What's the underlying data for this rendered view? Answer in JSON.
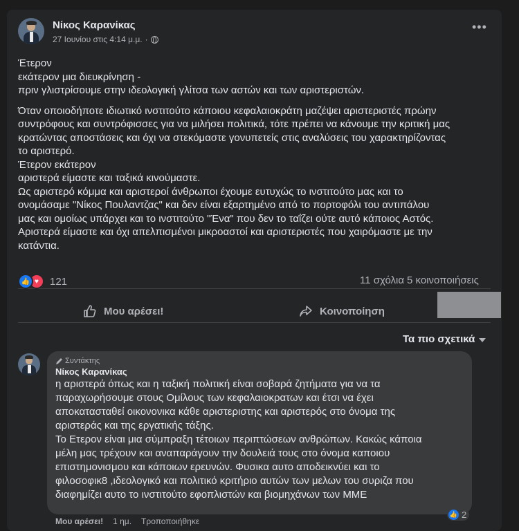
{
  "post": {
    "author": "Νίκος Καρανίκας",
    "timestamp": "27 Ιουνίου στις 4:14 μ.μ.",
    "separator": "·",
    "body": [
      "Έτερον",
      "εκάτερον μια διευκρίνηση -",
      "πριν γλιστρίσουμε στην ιδεολογική γλίτσα των αστών και των αριστεριστών.",
      "",
      "Όταν οποιοδήποτε ιδιωτικό ινστιτούτο κάποιου  κεφαλαιοκράτη μαζέψει αριστεριστές πρώην",
      "συντρόφους και συντρόφισσες για να μιλήσει πολιτικά, τότε πρέπει να κάνουμε την κριτική μας",
      "κρατώντας αποστάσεις και όχι να στεκόμαστε γονυπετείς στις αναλύσεις του χαρακτηρίζοντας",
      "το αριστερό.",
      "Έτερον εκάτερον",
      "αριστερά είμαστε και ταξικά κινούμαστε.",
      "Ως αριστερό κόμμα και αριστεροί άνθρωποι έχουμε ευτυχώς το ινστιτούτο μας και το",
      "ονομάσαμε \"Νίκος Πουλαντζας\" και δεν είναι εξαρτημένο από το πορτοφόλι του αντιπάλου",
      "μας και ομοίως υπάρχει και το ινστιτούτο \"Ένα\"  που δεν το ταΐζει ούτε αυτό κάποιος Αστός.",
      "Αριστερά είμαστε και όχι απελπισμένοι μικροαστοί και αριστεριστές που χαιρόμαστε με την",
      "κατάντια."
    ],
    "reaction_count": "121",
    "comments": "11 σχόλια",
    "shares": "5 κοινοποιήσεις",
    "like_label": "Μου αρέσει!",
    "share_label": "Κοινοποίηση",
    "sort_label": "Τα πιο σχετικά"
  },
  "comment": {
    "badge": "Συντάκτης",
    "author": "Νίκος Καρανίκας",
    "body": [
      "η αριστερά όπως και η ταξική πολιτική είναι σοβαρά ζητήματα για να τα",
      "παραχωρήσουμε στους Ομίλους των κεφαλαιοκρατων και έτσι να έχει",
      "αποκατασταθεί οικονονικα κάθε αριστεριστης και αριστερός στο όνομα της",
      "αριστεράς και της εργατικής τάξης.",
      "Το Ετερον είναι μια σύμπραξη τέτοιων περιπτώσεων ανθρώπων. Κακώς κάποια",
      "μέλη μας τρέχουν και αναπαράγουν την δουλειά τους στο όνομα καποιου",
      "επιστημονισμου και κάποιων ερευνών. Φυσικα αυτο αποδεικνύει και το",
      "φιλοσοφικ8 ,ιδεολογικό και πολιτικό κριτήριο αυτών των μελων του συριζα που",
      "διαφημίζει αυτο το ινστιτούτο εφοπλιστών και βιομηχάνων των ΜΜΕ"
    ],
    "like_label": "Μου αρέσει!",
    "time": "1 ημ.",
    "edited": "Τροποποιήθηκε",
    "reaction_count": "2"
  },
  "icons": {
    "globe": "globe-icon",
    "more": "more-options-icon",
    "like": "thumbs-up-icon",
    "love": "heart-icon",
    "share": "share-arrow-icon",
    "caret": "caret-down-icon",
    "pencil": "pencil-icon"
  },
  "colors": {
    "background": "#1c1c1d",
    "card": "#242526",
    "bubble": "#3a3b3c",
    "like_blue": "#1877f2",
    "love_red": "#f33e58",
    "text": "#e4e6eb",
    "muted": "#b0b3b8",
    "redaction": "#8e8f92"
  }
}
